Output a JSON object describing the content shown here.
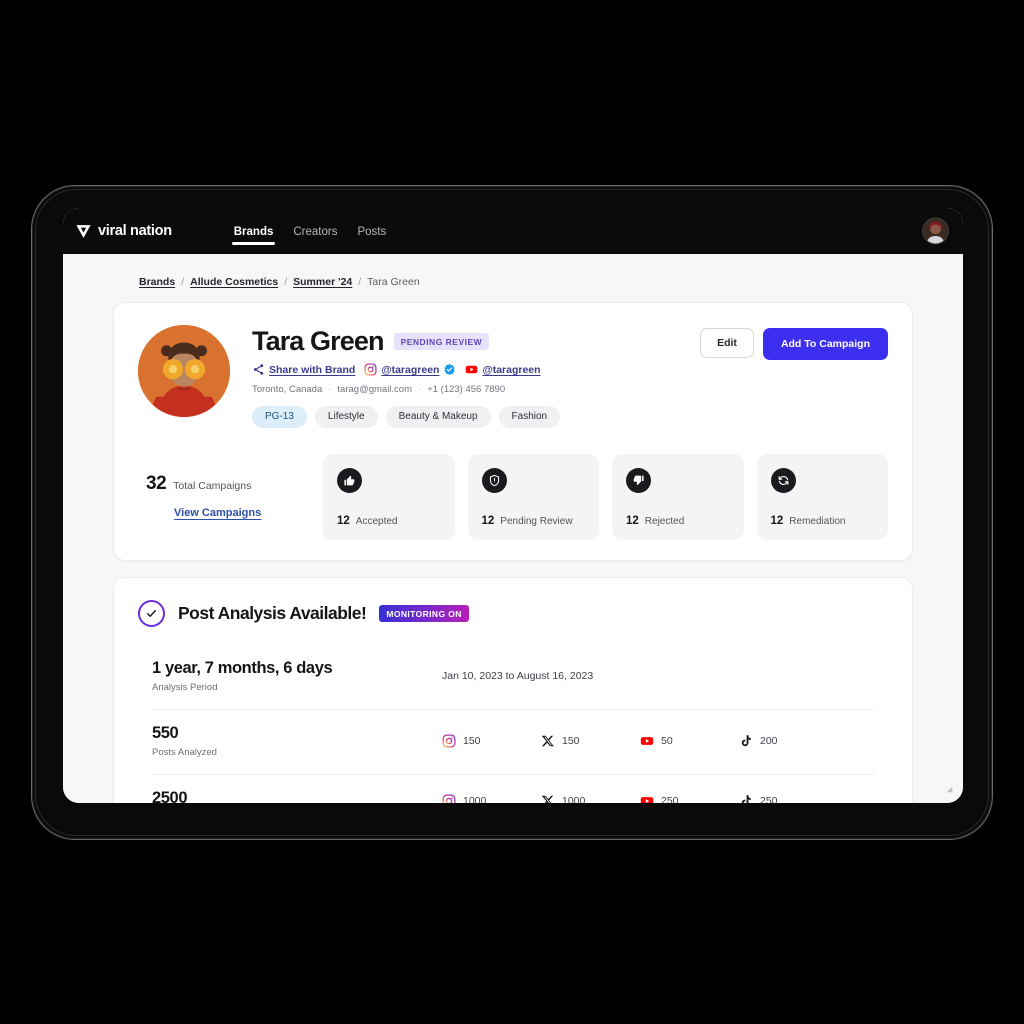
{
  "nav": {
    "logo_text": "viral nation",
    "logo_icon": "viral-nation-chevron-logo",
    "tabs": [
      {
        "label": "Brands",
        "active": true
      },
      {
        "label": "Creators",
        "active": false
      },
      {
        "label": "Posts",
        "active": false
      }
    ],
    "avatar_icon": "user-avatar"
  },
  "breadcrumb": {
    "items": [
      {
        "label": "Brands",
        "link": true
      },
      {
        "label": "Allude Cosmetics",
        "link": true
      },
      {
        "label": "Summer '24",
        "link": true
      },
      {
        "label": "Tara Green",
        "link": false
      }
    ],
    "separator": "/"
  },
  "profile": {
    "avatar_icon": "creator-photo-orange",
    "name": "Tara Green",
    "status_badge": "PENDING REVIEW",
    "links": [
      {
        "icon": "share-nodes-icon",
        "label": "Share with Brand",
        "verified": false
      },
      {
        "icon": "instagram-icon",
        "label": "@taragreen",
        "verified": true
      },
      {
        "icon": "youtube-icon",
        "label": "@taragreen",
        "verified": false
      }
    ],
    "meta": {
      "location": "Toronto, Canada",
      "email": "tarag@gmail.com",
      "phone": "+1 (123) 456 7890",
      "separator": "·"
    },
    "chips": [
      {
        "label": "PG-13",
        "rating": true
      },
      {
        "label": "Lifestyle",
        "rating": false
      },
      {
        "label": "Beauty & Makeup",
        "rating": false
      },
      {
        "label": "Fashion",
        "rating": false
      }
    ],
    "actions": {
      "edit_label": "Edit",
      "add_to_campaign_label": "Add To Campaign"
    }
  },
  "campaigns": {
    "total_count": "32",
    "total_label": "Total Campaigns",
    "view_link": "View Campaigns",
    "stats": [
      {
        "icon": "thumbs-up-icon",
        "count": "12",
        "label": "Accepted"
      },
      {
        "icon": "shield-icon",
        "count": "12",
        "label": "Pending Review"
      },
      {
        "icon": "thumbs-down-icon",
        "count": "12",
        "label": "Rejected"
      },
      {
        "icon": "refresh-icon",
        "count": "12",
        "label": "Remediation"
      }
    ]
  },
  "analysis": {
    "check_icon": "check-circle-icon",
    "title": "Post Analysis Available!",
    "monitoring_badge": "MONITORING ON",
    "rows": [
      {
        "value": "1 year, 7 months, 6 days",
        "sub": "Analysis Period",
        "daterange": "Jan 10, 2023 to August 16, 2023",
        "platforms": []
      },
      {
        "value": "550",
        "sub": "Posts Analyzed",
        "daterange": "",
        "platforms": [
          {
            "icon": "instagram-icon",
            "count": "150"
          },
          {
            "icon": "x-twitter-icon",
            "count": "150"
          },
          {
            "icon": "youtube-icon",
            "count": "50"
          },
          {
            "icon": "tiktok-icon",
            "count": "200"
          }
        ]
      },
      {
        "value": "2500",
        "sub": "",
        "daterange": "",
        "platforms": [
          {
            "icon": "instagram-icon",
            "count": "1000"
          },
          {
            "icon": "x-twitter-icon",
            "count": "1000"
          },
          {
            "icon": "youtube-icon",
            "count": "250"
          },
          {
            "icon": "tiktok-icon",
            "count": "250"
          }
        ]
      }
    ]
  },
  "colors": {
    "primary_button": "#3d2ff0",
    "badge_purple_bg": "#e7e1fb",
    "badge_purple_text": "#5b4bb7",
    "monitoring_gradient_start": "#3730d8",
    "monitoring_gradient_end": "#b81fb8",
    "check_ring": "#6b2fd6",
    "rating_chip_bg": "#ddeefb",
    "link_blue": "#3b3b8c",
    "view_link_blue": "#2d4fa8",
    "youtube_red": "#ff0000",
    "nav_background": "#0b0b0c",
    "page_background": "#f7f7f8"
  }
}
